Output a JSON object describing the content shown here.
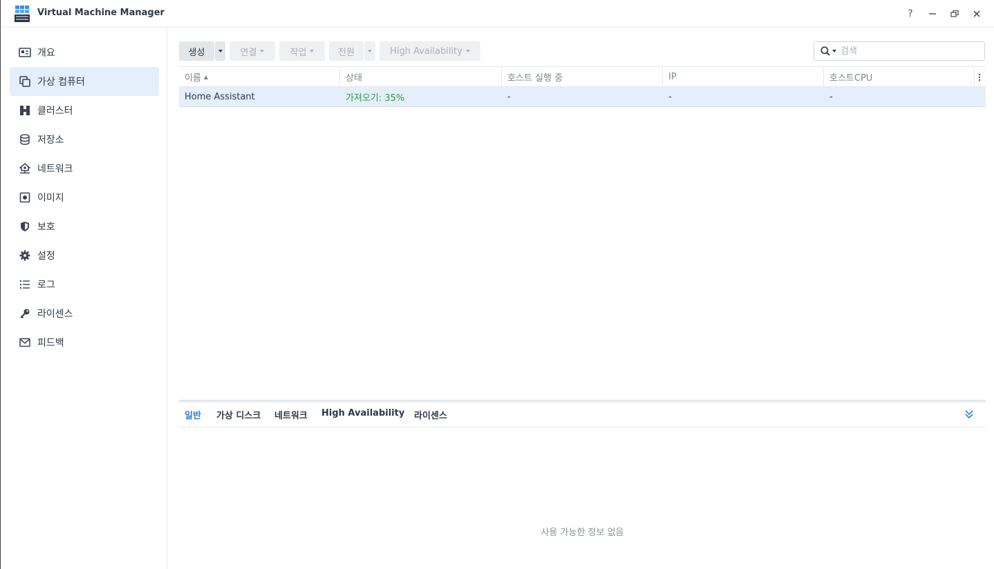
{
  "window": {
    "title": "Virtual Machine Manager",
    "controls": [
      "?",
      "—",
      "restore",
      "✕"
    ]
  },
  "sidebar": {
    "items": [
      {
        "label": "개요",
        "icon": "overview-icon"
      },
      {
        "label": "가상 컴퓨터",
        "icon": "virtual-machine-icon",
        "active": true
      },
      {
        "label": "클러스터",
        "icon": "cluster-icon"
      },
      {
        "label": "저장소",
        "icon": "storage-icon"
      },
      {
        "label": "네트워크",
        "icon": "network-icon"
      },
      {
        "label": "이미지",
        "icon": "image-icon"
      },
      {
        "label": "보호",
        "icon": "shield-icon"
      },
      {
        "label": "설정",
        "icon": "gear-icon"
      },
      {
        "label": "로그",
        "icon": "log-icon"
      },
      {
        "label": "라이센스",
        "icon": "key-icon"
      },
      {
        "label": "피드백",
        "icon": "mail-icon"
      }
    ]
  },
  "toolbar": {
    "create_label": "생성",
    "connect_label": "연결",
    "action_label": "작업",
    "power_label": "전원",
    "ha_label": "High Availability",
    "search_placeholder": "검색"
  },
  "grid": {
    "columns": [
      "이름",
      "상태",
      "호스트 실행 중",
      "IP",
      "호스트CPU"
    ],
    "sort_indicator": "▲",
    "rows": [
      {
        "name": "Home Assistant",
        "status": "가져오기: 35%",
        "host": "-",
        "ip": "-",
        "cpu": "-"
      }
    ]
  },
  "detail": {
    "tabs": [
      "일반",
      "가상 디스크",
      "네트워크",
      "High Availability",
      "라이센스"
    ],
    "active_tab": "일반",
    "empty_message": "사용 가능한 정보 없음"
  },
  "colors": {
    "accent": "#2a7fd4",
    "selected_row": "#e4effb",
    "status_green": "#2e9a3c"
  }
}
